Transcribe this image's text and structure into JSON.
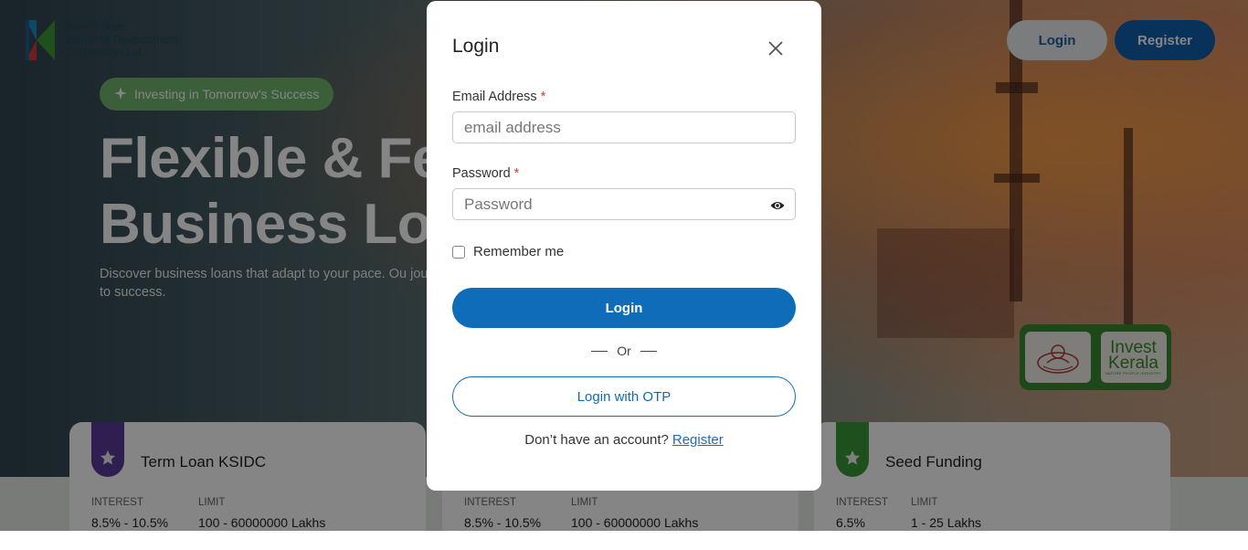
{
  "header": {
    "logo_lines": [
      "Kerala State",
      "Industrial Development",
      "Corporation Ltd."
    ],
    "login_label": "Login",
    "register_label": "Register"
  },
  "hero": {
    "badge": "Investing in Tomorrow's Success",
    "headline_line1": "Flexible & Fe",
    "headline_line2": "Business Lo",
    "subtext": "Discover business loans that adapt to your pace. Ou journey to success.",
    "seal_text_1": "Invest",
    "seal_text_2": "Kerala",
    "seal_text_3": "NATURE  PEOPLE  INDUSTRY"
  },
  "cards": [
    {
      "title": "Term Loan KSIDC",
      "interest_label": "INTEREST",
      "interest": "8.5% - 10.5%",
      "limit_label": "LIMIT",
      "limit": "100 - 60000000 Lakhs",
      "color": "#5a3d99"
    },
    {
      "title": "",
      "interest_label": "INTEREST",
      "interest": "8.5% - 10.5%",
      "limit_label": "LIMIT",
      "limit": "100 - 60000000 Lakhs",
      "color": "#3a7fc1"
    },
    {
      "title": "Seed Funding",
      "interest_label": "INTEREST",
      "interest": "6.5%",
      "limit_label": "LIMIT",
      "limit": "1 - 25 Lakhs",
      "color": "#3b9a3a"
    }
  ],
  "modal": {
    "title": "Login",
    "email_label": "Email Address",
    "email_placeholder": "email address",
    "password_label": "Password",
    "password_placeholder": "Password",
    "required_mark": "*",
    "remember_label": "Remember me",
    "login_button": "Login",
    "or_text": "Or",
    "otp_button": "Login with OTP",
    "no_account_text": "Don’t have an account?",
    "register_link": "Register"
  },
  "colors": {
    "primary": "#0e6cb8",
    "accent_green": "#6fb66e",
    "required": "#d23b3b"
  }
}
